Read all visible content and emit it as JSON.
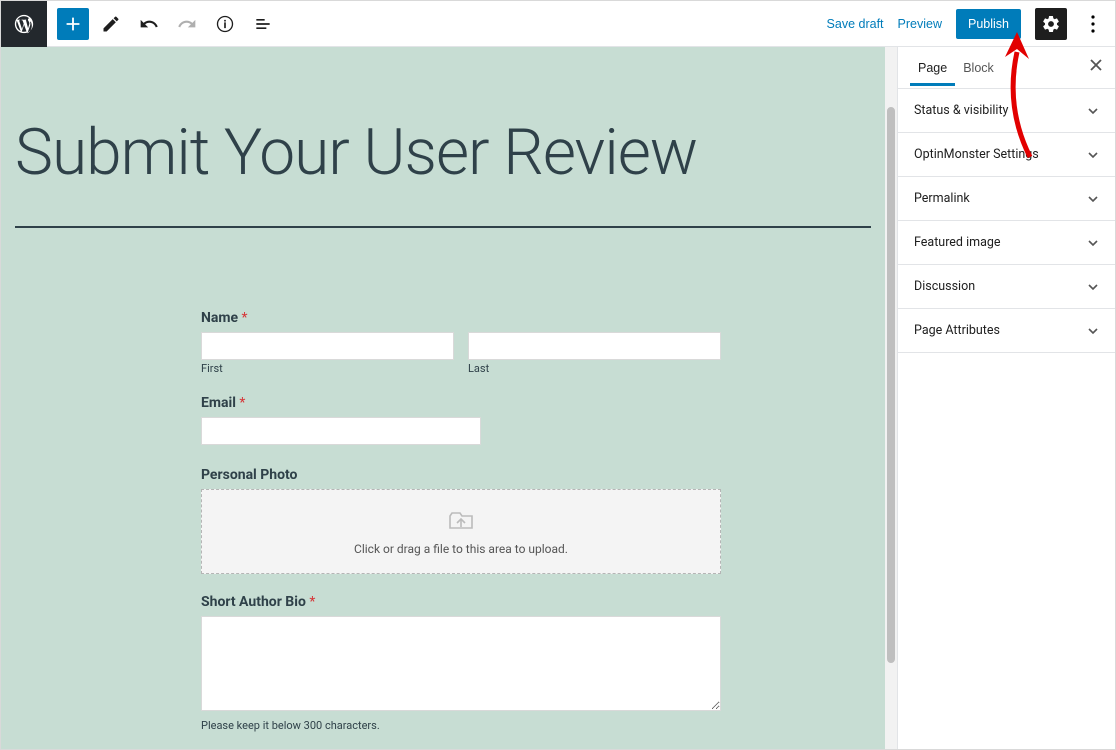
{
  "toolbar": {
    "save_draft": "Save draft",
    "preview": "Preview",
    "publish": "Publish"
  },
  "sidebar": {
    "tabs": {
      "page": "Page",
      "block": "Block"
    },
    "panels": [
      "Status & visibility",
      "OptinMonster Settings",
      "Permalink",
      "Featured image",
      "Discussion",
      "Page Attributes"
    ]
  },
  "page": {
    "title": "Submit Your User Review"
  },
  "form": {
    "name_label": "Name",
    "first_sub": "First",
    "last_sub": "Last",
    "email_label": "Email",
    "photo_label": "Personal Photo",
    "upload_text": "Click or drag a file to this area to upload.",
    "bio_label": "Short Author Bio",
    "bio_help": "Please keep it below 300 characters.",
    "required_mark": "*"
  }
}
